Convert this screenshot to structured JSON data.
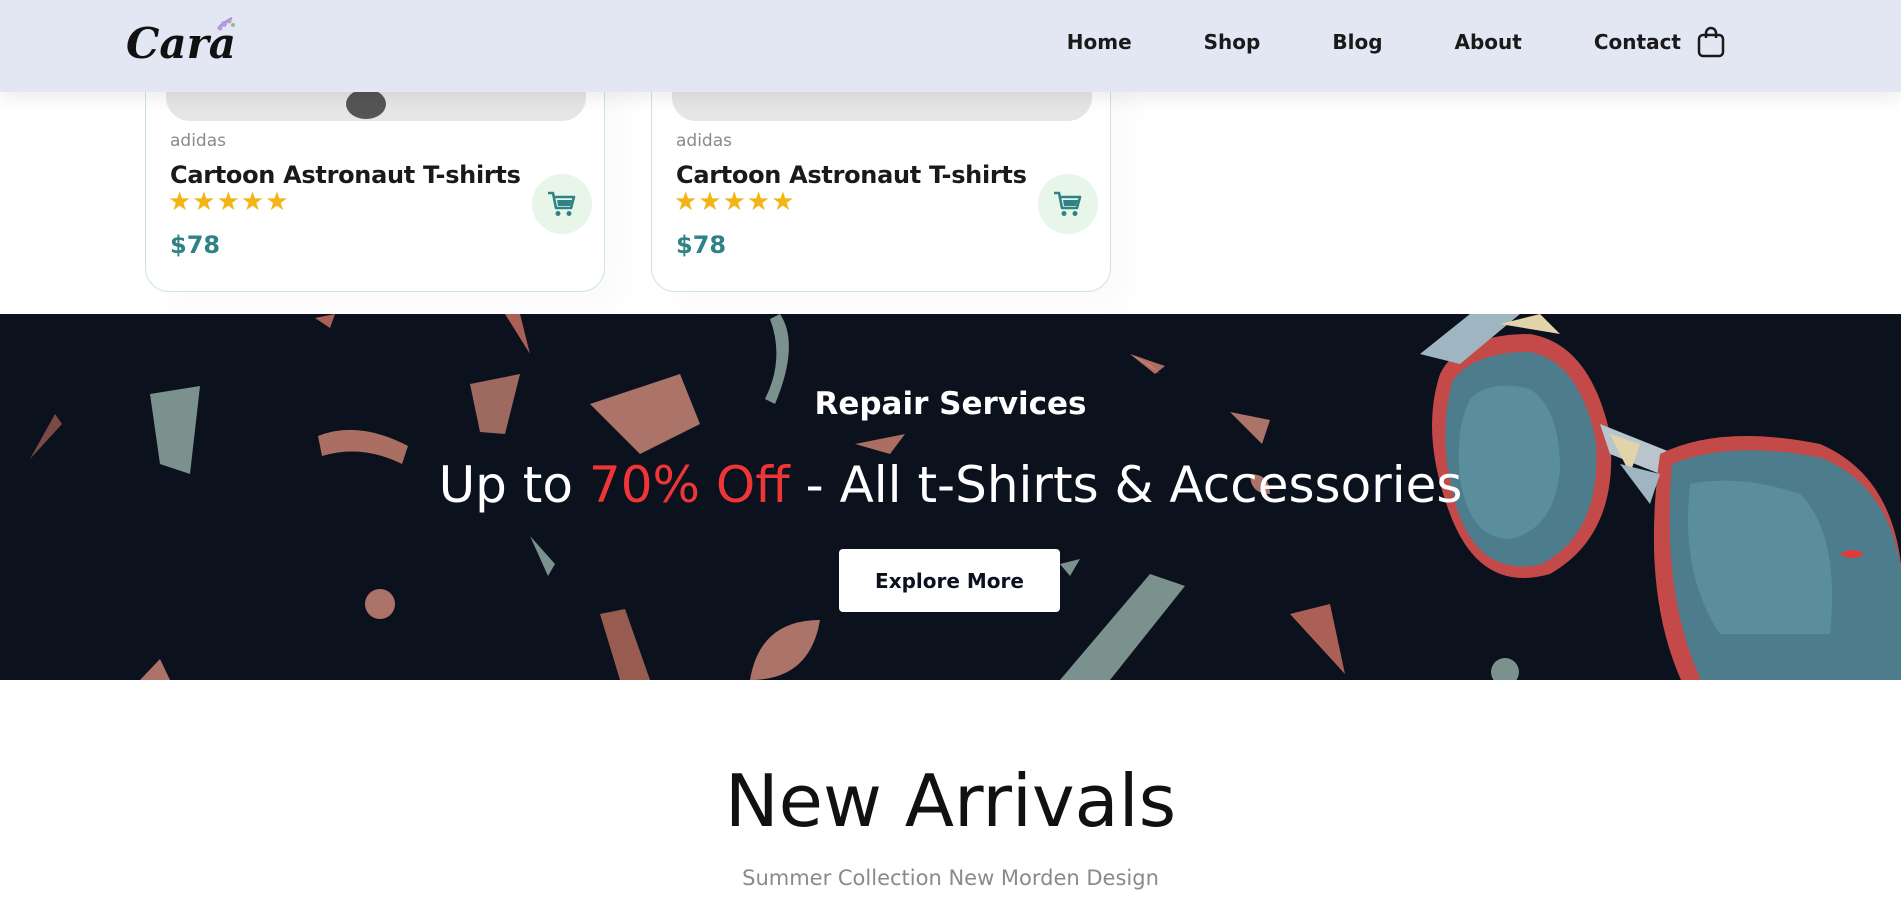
{
  "header": {
    "logo_text": "Cara",
    "nav": [
      "Home",
      "Shop",
      "Blog",
      "About",
      "Contact"
    ]
  },
  "products": [
    {
      "brand": "adidas",
      "name": "Cartoon Astronaut T-shirts",
      "rating": 5,
      "stars": "★★★★★",
      "price": "$78"
    },
    {
      "brand": "adidas",
      "name": "Cartoon Astronaut T-shirts",
      "rating": 5,
      "stars": "★★★★★",
      "price": "$78"
    }
  ],
  "banner": {
    "subtitle": "Repair Services",
    "title_prefix": "Up to ",
    "title_accent": "70% Off",
    "title_suffix": " - All t-Shirts & Accessories",
    "button_label": "Explore More"
  },
  "new_arrivals": {
    "title": "New Arrivals",
    "subtitle": "Summer Collection New Morden Design"
  },
  "colors": {
    "header_bg": "#e3e6f3",
    "accent_teal": "#2f8285",
    "star_yellow": "#f3b516",
    "banner_bg": "#0b111d",
    "accent_red": "#ef3636"
  },
  "icons": {
    "cart_nav": "shopping-bag-icon",
    "add_to_cart": "cart-icon"
  }
}
